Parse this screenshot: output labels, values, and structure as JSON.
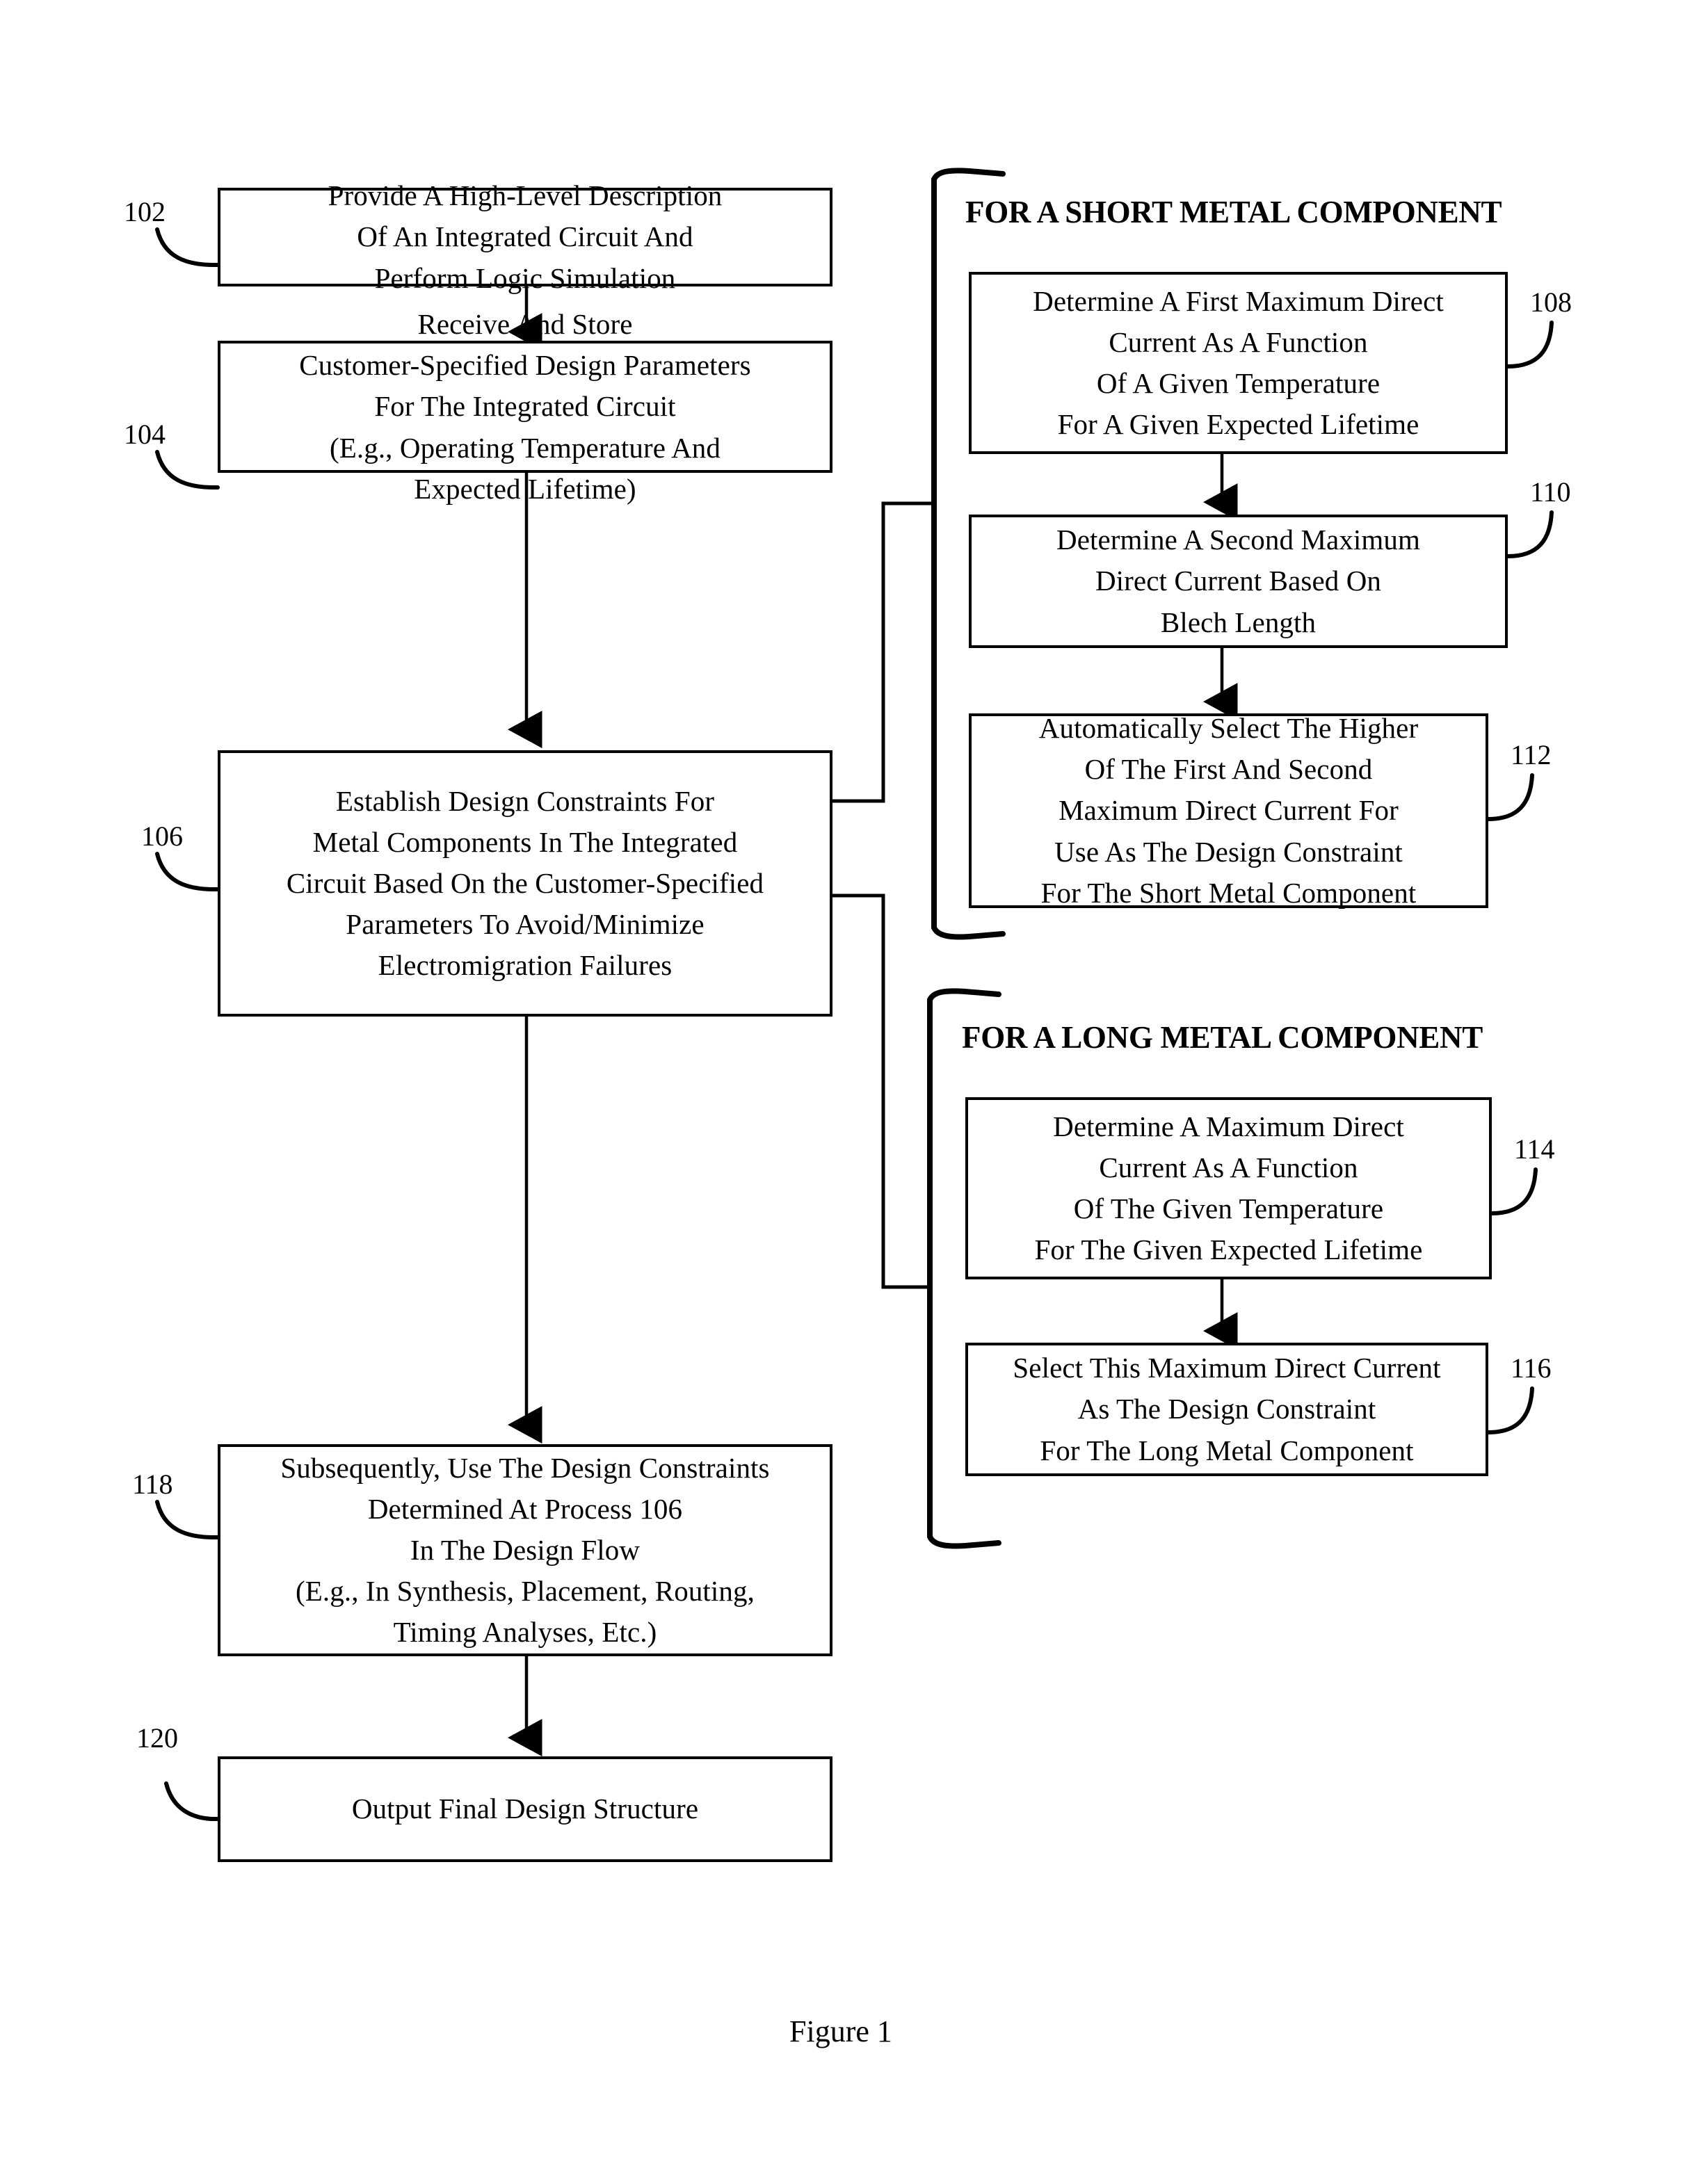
{
  "figure": {
    "caption": "Figure 1"
  },
  "sections": [
    {
      "id": "short-metal",
      "heading": "FOR A SHORT METAL COMPONENT"
    },
    {
      "id": "long-metal",
      "heading": "FOR A LONG METAL COMPONENT"
    }
  ],
  "boxes": [
    {
      "ref": "102",
      "text": "Provide A High-Level Description\nOf An Integrated Circuit And\nPerform Logic Simulation"
    },
    {
      "ref": "104",
      "text": "Receive And Store\nCustomer-Specified Design Parameters\nFor The Integrated Circuit\n(E.g., Operating Temperature And\nExpected Lifetime)"
    },
    {
      "ref": "106",
      "text": "Establish Design Constraints For\nMetal Components In The Integrated\nCircuit Based On the Customer-Specified\nParameters To Avoid/Minimize\nElectromigration Failures"
    },
    {
      "ref": "108",
      "text": "Determine A First Maximum Direct\nCurrent As A Function\nOf A Given Temperature\nFor A Given Expected Lifetime"
    },
    {
      "ref": "110",
      "text": "Determine A Second Maximum\nDirect Current Based On\nBlech Length"
    },
    {
      "ref": "112",
      "text": "Automatically Select The Higher\nOf The First And Second\nMaximum Direct Current For\nUse As The Design Constraint\nFor The Short Metal Component"
    },
    {
      "ref": "114",
      "text": "Determine A Maximum Direct\nCurrent As A Function\nOf The Given Temperature\nFor The Given Expected Lifetime"
    },
    {
      "ref": "116",
      "text": "Select This Maximum Direct Current\nAs The Design Constraint\nFor The Long Metal Component"
    },
    {
      "ref": "118",
      "text": "Subsequently, Use The Design Constraints\nDetermined At Process 106\nIn The Design Flow\n(E.g., In Synthesis, Placement, Routing,\nTiming Analyses, Etc.)"
    },
    {
      "ref": "120",
      "text": "Output Final Design Structure"
    }
  ],
  "colors": {
    "line": "#000000",
    "background": "#ffffff",
    "text": "#000000"
  }
}
